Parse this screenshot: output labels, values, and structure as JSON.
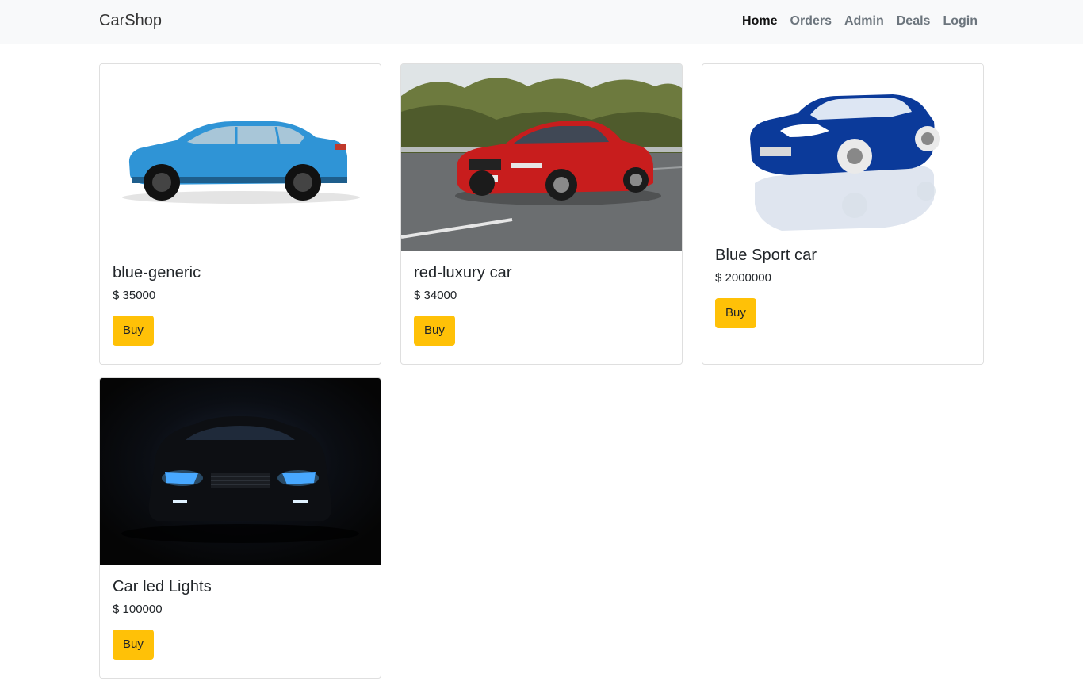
{
  "nav": {
    "brand": "CarShop",
    "links": [
      "Home",
      "Orders",
      "Admin",
      "Deals",
      "Login"
    ],
    "active": "Home"
  },
  "cards": [
    {
      "title": "blue-generic",
      "price": "$ 35000",
      "button": "Buy"
    },
    {
      "title": "red-luxury car",
      "price": "$ 34000",
      "button": "Buy"
    },
    {
      "title": "Blue Sport car",
      "price": "$ 2000000",
      "button": "Buy"
    },
    {
      "title": "Car led Lights",
      "price": "$ 100000",
      "button": "Buy"
    }
  ],
  "colors": {
    "navbar_bg": "#f8f9fa",
    "button_bg": "#ffc107"
  }
}
